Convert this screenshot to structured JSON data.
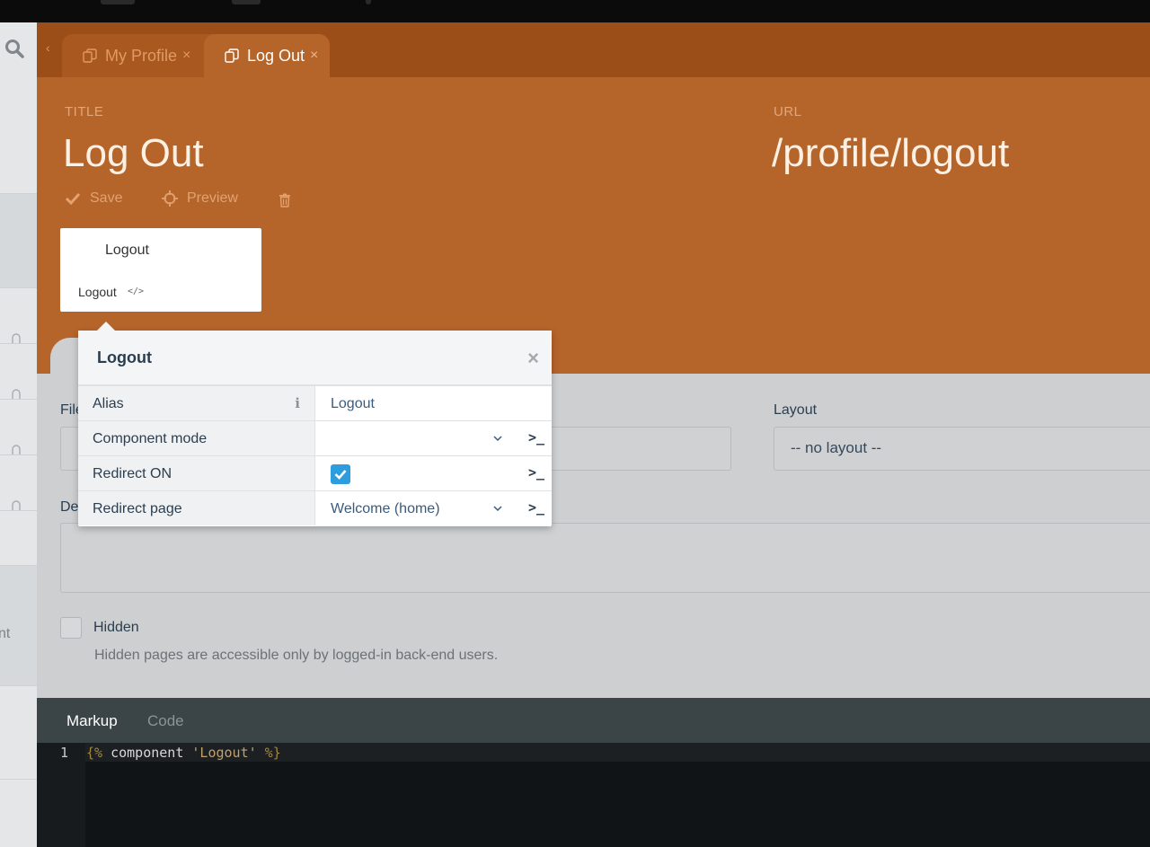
{
  "tabs": [
    {
      "label": "My Profile",
      "close": "×"
    },
    {
      "label": "Log Out",
      "close": "×"
    }
  ],
  "header": {
    "title_label": "TITLE",
    "title_value": "Log Out",
    "url_label": "URL",
    "url_value": "/profile/logout"
  },
  "toolbar": {
    "save_label": "Save",
    "preview_label": "Preview"
  },
  "component_card": {
    "name": "Logout",
    "alias": "Logout",
    "alias_icon": "</>"
  },
  "popover": {
    "title": "Logout",
    "close": "×",
    "rows": [
      {
        "name": "Alias",
        "value": "Logout",
        "info": "i"
      },
      {
        "name": "Component mode",
        "value": "",
        "term": ">_"
      },
      {
        "name": "Redirect ON",
        "checked": true,
        "term": ">_"
      },
      {
        "name": "Redirect page",
        "value": "Welcome (home)",
        "term": ">_"
      }
    ]
  },
  "form": {
    "file_label_fragment": "File",
    "layout_label": "Layout",
    "layout_value": "-- no layout --",
    "description_label_fragment": "De",
    "hidden_label": "Hidden",
    "hidden_help": "Hidden pages are accessible only by logged-in back-end users."
  },
  "editor": {
    "tabs": [
      "Markup",
      "Code"
    ],
    "line_number": "1",
    "code_open": "{%",
    "code_mid": " component ",
    "code_string": "'Logout'",
    "code_close": " %}"
  },
  "sidebar": {
    "fragment_text": "nt"
  },
  "colors": {
    "accent": "#b5642a",
    "tab_bar": "#9b4e18",
    "checkbox": "#2e9dde",
    "editor_bg": "#111416"
  }
}
